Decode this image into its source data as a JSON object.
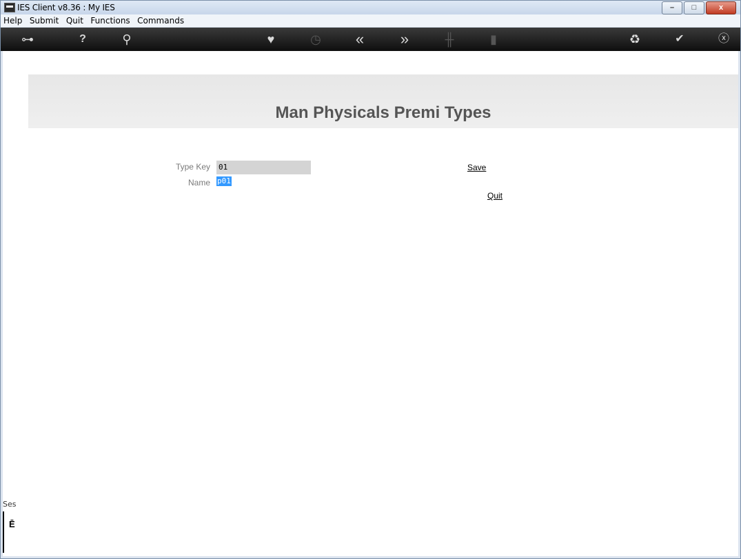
{
  "window": {
    "title": "IES Client v8.36 : My IES"
  },
  "window_controls": {
    "minimize": "–",
    "maximize": "□",
    "close": "x"
  },
  "menu": [
    "Help",
    "Submit",
    "Quit",
    "Functions",
    "Commands"
  ],
  "toolbar": {
    "icons": [
      "key-icon",
      "help-icon",
      "search-icon",
      "heart-icon",
      "clock-icon",
      "rewind-icon",
      "fast-forward-icon",
      "tools-icon",
      "page-icon",
      "recycle-icon",
      "check-icon",
      "close-icon"
    ],
    "glyphs": {
      "key": "⊶",
      "help": "?",
      "search": "⚲",
      "heart": "♥",
      "clock": "◷",
      "rewind": "«",
      "forward": "»",
      "tools": "╫",
      "page": "▮",
      "recycle": "♻",
      "check": "✔",
      "close": "ⓧ"
    }
  },
  "form": {
    "title": "Man Physicals Premi Types",
    "type_key_label": "Type Key",
    "type_key_value": "01",
    "name_label": "Name",
    "name_value": "p01",
    "save_label": "Save",
    "quit_label": "Quit"
  },
  "side_panel": {
    "label": "Ses",
    "icon_glyph": "Ē"
  },
  "colors": {
    "toolbar_bg": "#1a1a1a",
    "selection": "#3399ff",
    "title_text": "#555555",
    "field_bg": "#d4d4d4"
  }
}
